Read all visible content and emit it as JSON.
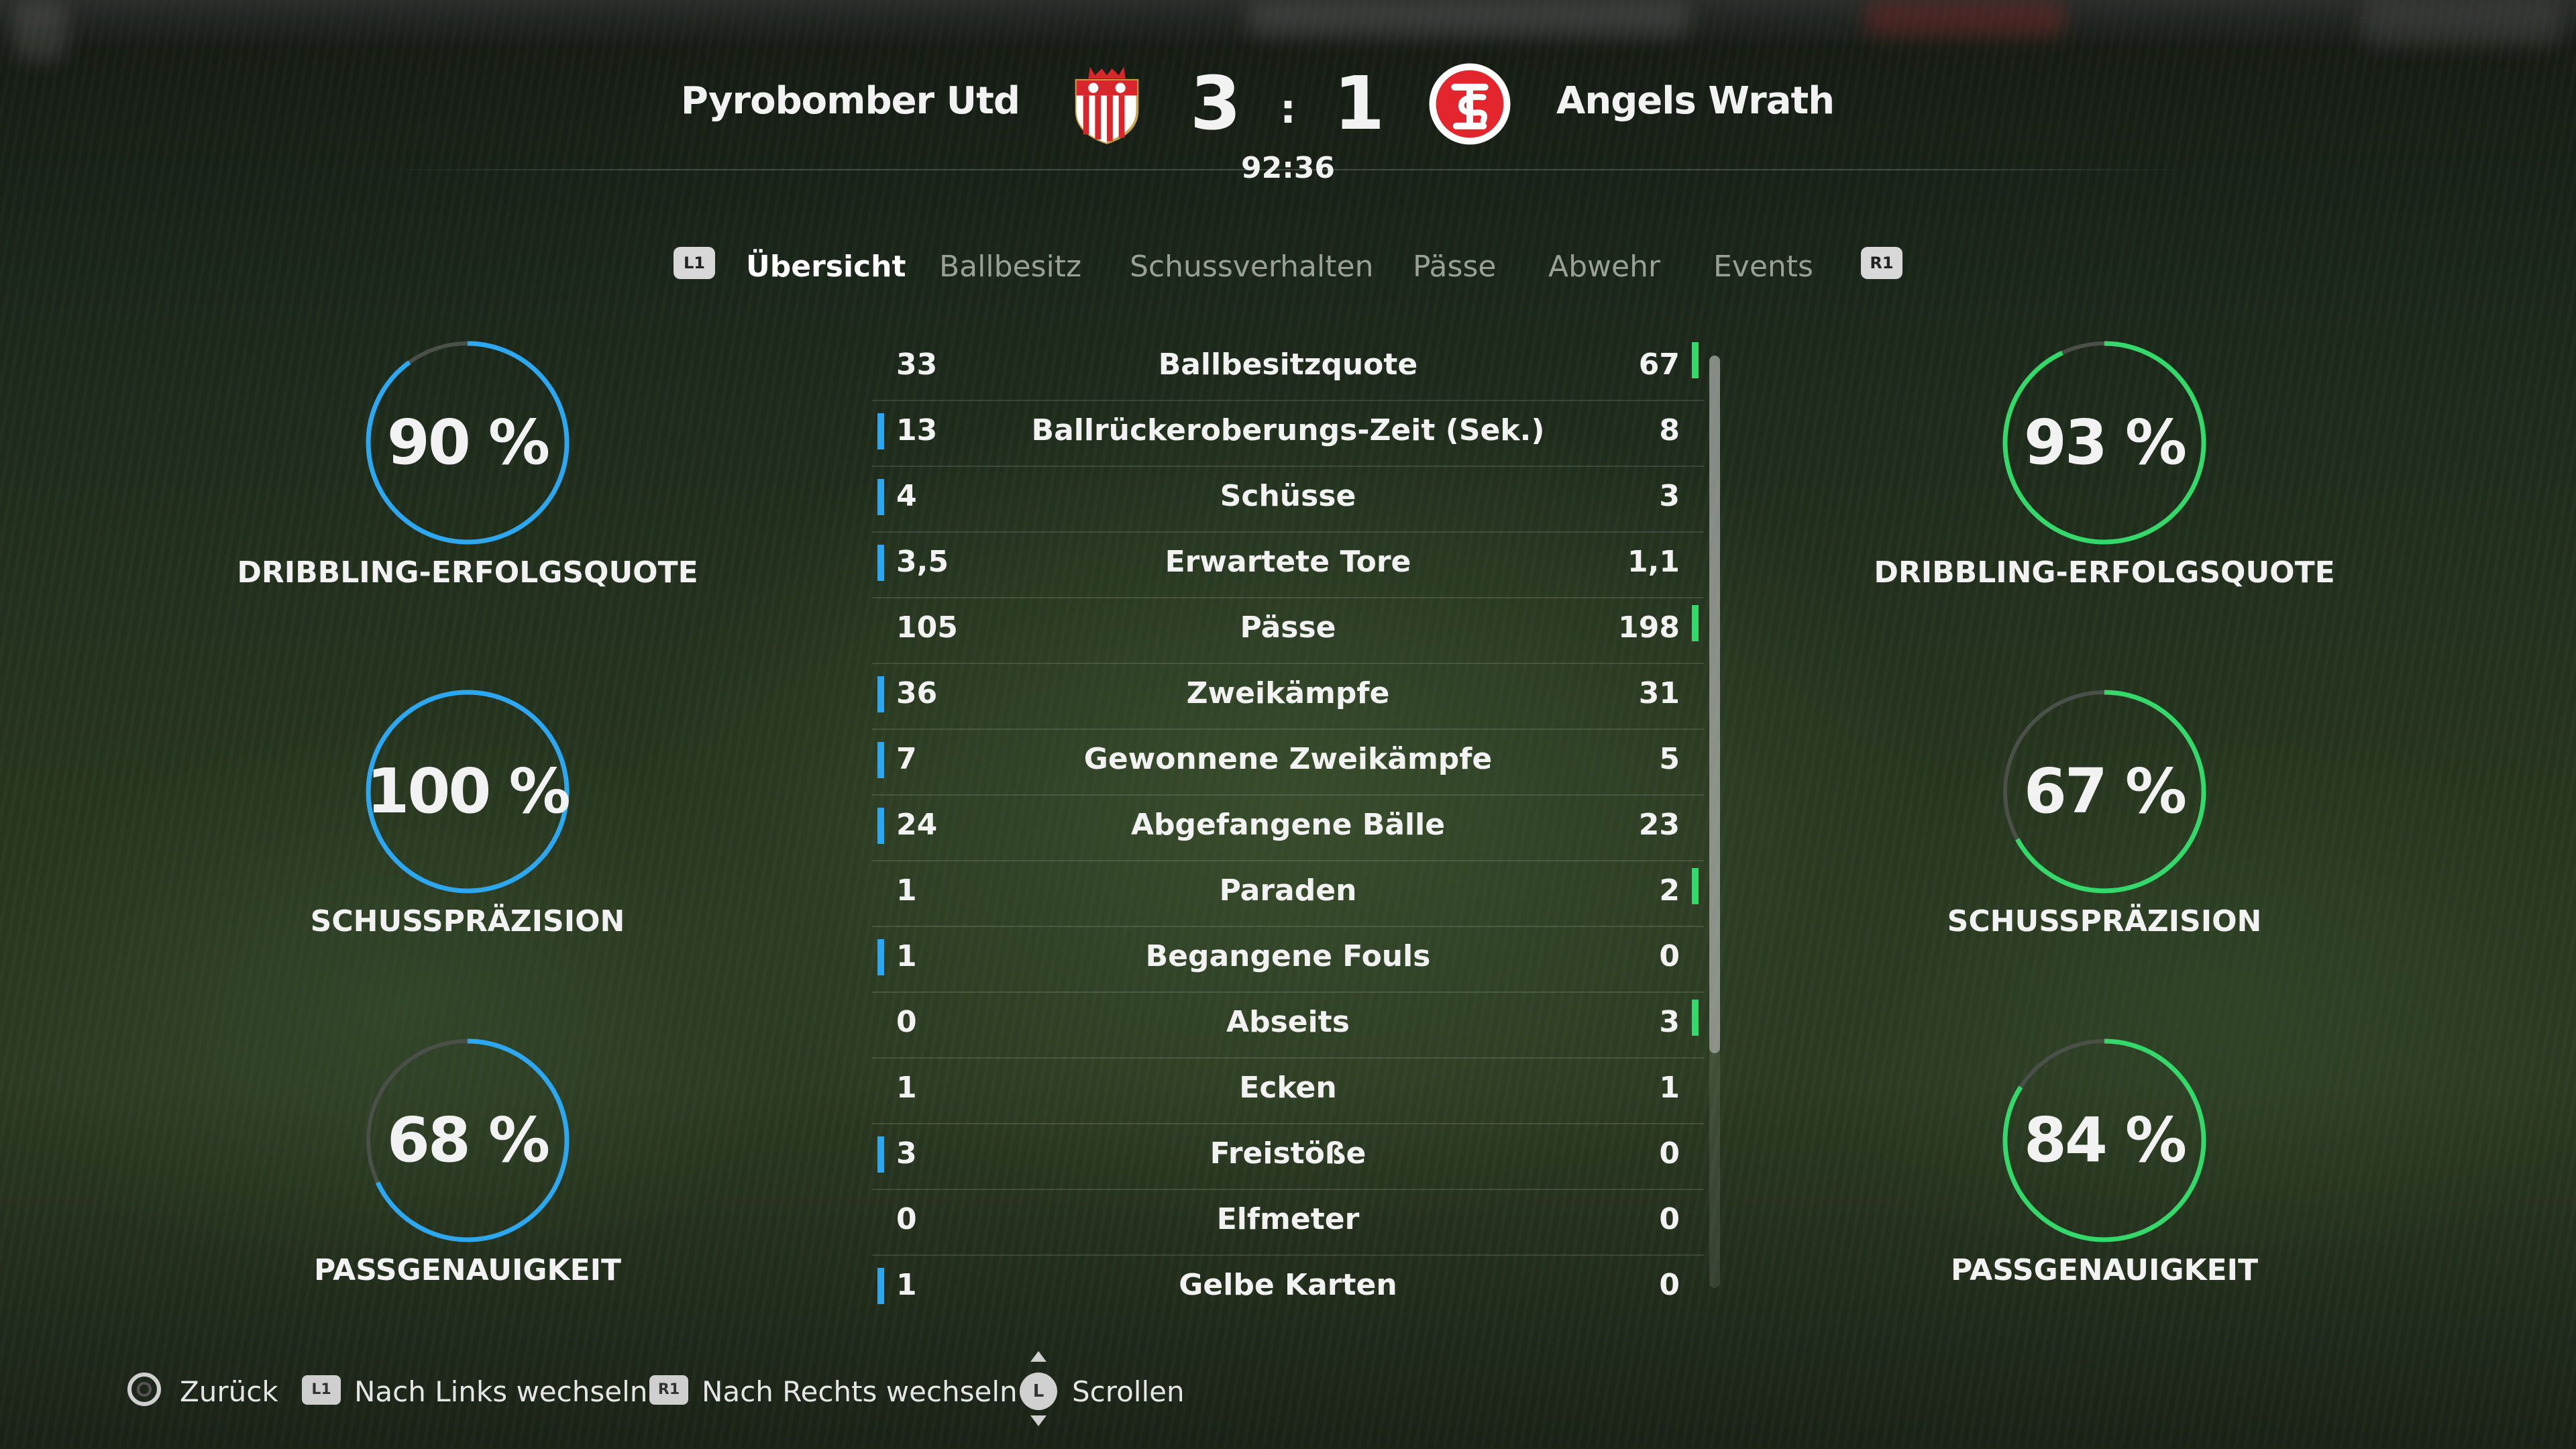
{
  "match": {
    "home_team": "Pyrobomber Utd",
    "away_team": "Angels Wrath",
    "home_score": "3",
    "away_score": "1",
    "separator": ":",
    "clock": "92:36"
  },
  "tabs": {
    "left_button": "L1",
    "right_button": "R1",
    "items": [
      {
        "label": "Übersicht",
        "active": true
      },
      {
        "label": "Ballbesitz",
        "active": false
      },
      {
        "label": "Schussverhalten",
        "active": false
      },
      {
        "label": "Pässe",
        "active": false
      },
      {
        "label": "Abwehr",
        "active": false
      },
      {
        "label": "Events",
        "active": false
      }
    ]
  },
  "stats": [
    {
      "label": "Ballbesitzquote",
      "home": "33",
      "away": "67",
      "leader": "away"
    },
    {
      "label": "Ballrückeroberungs-Zeit (Sek.)",
      "home": "13",
      "away": "8",
      "leader": "home"
    },
    {
      "label": "Schüsse",
      "home": "4",
      "away": "3",
      "leader": "home"
    },
    {
      "label": "Erwartete Tore",
      "home": "3,5",
      "away": "1,1",
      "leader": "home"
    },
    {
      "label": "Pässe",
      "home": "105",
      "away": "198",
      "leader": "away"
    },
    {
      "label": "Zweikämpfe",
      "home": "36",
      "away": "31",
      "leader": "home"
    },
    {
      "label": "Gewonnene Zweikämpfe",
      "home": "7",
      "away": "5",
      "leader": "home"
    },
    {
      "label": "Abgefangene Bälle",
      "home": "24",
      "away": "23",
      "leader": "home"
    },
    {
      "label": "Paraden",
      "home": "1",
      "away": "2",
      "leader": "away"
    },
    {
      "label": "Begangene Fouls",
      "home": "1",
      "away": "0",
      "leader": "home"
    },
    {
      "label": "Abseits",
      "home": "0",
      "away": "3",
      "leader": "away"
    },
    {
      "label": "Ecken",
      "home": "1",
      "away": "1",
      "leader": "none"
    },
    {
      "label": "Freistöße",
      "home": "3",
      "away": "0",
      "leader": "home"
    },
    {
      "label": "Elfmeter",
      "home": "0",
      "away": "0",
      "leader": "none"
    },
    {
      "label": "Gelbe Karten",
      "home": "1",
      "away": "0",
      "leader": "home"
    }
  ],
  "rings": {
    "home": [
      {
        "value": "90 %",
        "fraction": 0.9,
        "label": "DRIBBLING-ERFOLGSQUOTE"
      },
      {
        "value": "100 %",
        "fraction": 1.0,
        "label": "SCHUSSPRÄZISION"
      },
      {
        "value": "68 %",
        "fraction": 0.68,
        "label": "PASSGENAUIGKEIT"
      }
    ],
    "away": [
      {
        "value": "93 %",
        "fraction": 0.93,
        "label": "DRIBBLING-ERFOLGSQUOTE"
      },
      {
        "value": "67 %",
        "fraction": 0.67,
        "label": "SCHUSSPRÄZISION"
      },
      {
        "value": "84 %",
        "fraction": 0.84,
        "label": "PASSGENAUIGKEIT"
      }
    ]
  },
  "colors": {
    "home_accent": "#2da8f0",
    "away_accent": "#35d86a",
    "ring_track": "#4a4f48"
  },
  "footer": {
    "back": {
      "icon": "circle-button-icon",
      "label": "Zurück"
    },
    "left": {
      "icon": "L1",
      "label": "Nach Links wechseln"
    },
    "right": {
      "icon": "R1",
      "label": "Nach Rechts wechseln"
    },
    "scroll": {
      "icon": "L",
      "label": "Scrollen"
    }
  }
}
